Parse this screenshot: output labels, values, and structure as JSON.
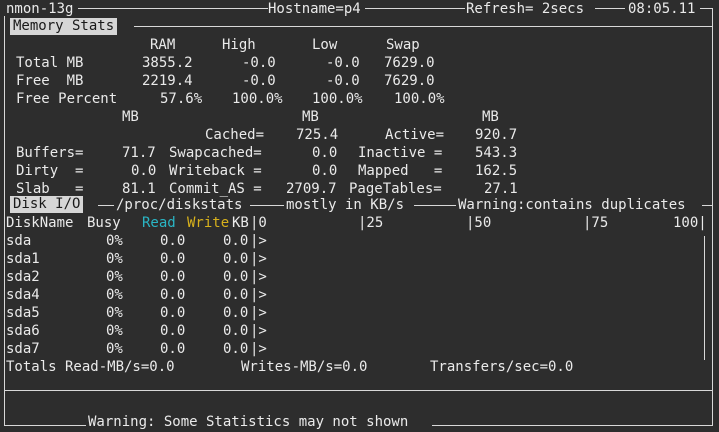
{
  "title_bar": {
    "app": "nmon-13g",
    "hostname": "Hostname=p4",
    "refresh": "Refresh= 2secs",
    "time": "08:05.11"
  },
  "memory": {
    "section_label": "Memory Stats",
    "headers": [
      "RAM",
      "High",
      "Low",
      "Swap"
    ],
    "rows": [
      {
        "label": "Total MB",
        "ram": "3855.2",
        "high": "-0.0",
        "low": "-0.0",
        "swap": "7629.0"
      },
      {
        "label": "Free  MB",
        "ram": "2219.4",
        "high": "-0.0",
        "low": "-0.0",
        "swap": "7629.0"
      },
      {
        "label": "Free Percent",
        "ram": "57.6%",
        "high": "100.0%",
        "low": "100.0%",
        "swap": "100.0%"
      }
    ],
    "units": [
      "MB",
      "MB",
      "MB"
    ],
    "details": [
      {
        "l1": "",
        "v1": "",
        "l2": "Cached=",
        "v2": "725.4",
        "l3": "Active=",
        "v3": "920.7"
      },
      {
        "l1": "Buffers=",
        "v1": "71.7",
        "l2": "Swapcached=",
        "v2": "0.0",
        "l3": "Inactive =",
        "v3": "543.3"
      },
      {
        "l1": "Dirty  =",
        "v1": "0.0",
        "l2": "Writeback =",
        "v2": "0.0",
        "l3": "Mapped   =",
        "v3": "162.5"
      },
      {
        "l1": "Slab   =",
        "v1": "81.1",
        "l2": "Commit_AS =",
        "v2": "2709.7",
        "l3": "PageTables=",
        "v3": "27.1"
      }
    ]
  },
  "disk": {
    "section_label": "Disk I/O",
    "source": "/proc/diskstats",
    "unit_note": "mostly in KB/s",
    "warning": "Warning:contains duplicates",
    "col_diskname": "DiskName",
    "col_busy": "Busy",
    "col_read": "Read",
    "col_write": "Write",
    "col_kb": "KB",
    "scale": [
      "|0",
      "|25",
      "|50",
      "|75",
      "100|"
    ],
    "rows": [
      {
        "name": "sda",
        "busy": "0%",
        "read": "0.0",
        "write": "0.0",
        "bar": "|>"
      },
      {
        "name": "sda1",
        "busy": "0%",
        "read": "0.0",
        "write": "0.0",
        "bar": "|>"
      },
      {
        "name": "sda2",
        "busy": "0%",
        "read": "0.0",
        "write": "0.0",
        "bar": "|>"
      },
      {
        "name": "sda4",
        "busy": "0%",
        "read": "0.0",
        "write": "0.0",
        "bar": "|>"
      },
      {
        "name": "sda5",
        "busy": "0%",
        "read": "0.0",
        "write": "0.0",
        "bar": "|>"
      },
      {
        "name": "sda6",
        "busy": "0%",
        "read": "0.0",
        "write": "0.0",
        "bar": "|>"
      },
      {
        "name": "sda7",
        "busy": "0%",
        "read": "0.0",
        "write": "0.0",
        "bar": "|>"
      }
    ],
    "totals": {
      "read": "Totals Read-MB/s=0.0",
      "writes": "Writes-MB/s=0.0",
      "transfers": "Transfers/sec=0.0"
    }
  },
  "footer": {
    "warning": "Warning: Some Statistics may not shown"
  }
}
